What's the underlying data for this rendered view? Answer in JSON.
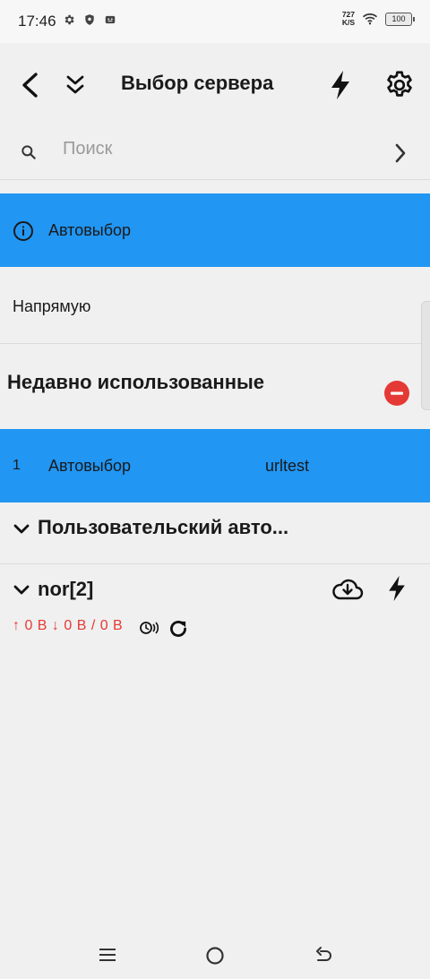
{
  "status_bar": {
    "time": "17:46",
    "net_speed_value": "727",
    "net_speed_unit": "K/S",
    "battery": "100"
  },
  "app_bar": {
    "title": "Выбор сервера"
  },
  "search": {
    "placeholder": "Поиск"
  },
  "rows": {
    "auto_select": "Автовыбор",
    "direct": "Напрямую"
  },
  "recent": {
    "title": "Недавно использованные",
    "items": [
      {
        "index": "1",
        "name": "Автовыбор",
        "type": "urltest"
      }
    ]
  },
  "groups": {
    "custom_title": "Пользовательский авто...",
    "nor_title": "nor[2]"
  },
  "traffic": {
    "text": "↑ 0 B ↓ 0 B / 0 B"
  },
  "colors": {
    "accent_blue": "#2196f3",
    "remove_red": "#e53935",
    "traffic_red": "#e53935"
  },
  "icons": {
    "back": "back-icon",
    "collapse": "double-chevron-down-icon",
    "bolt": "bolt-icon",
    "settings": "gear-icon",
    "search": "search-icon",
    "forward": "chevron-right-icon",
    "info": "info-icon",
    "remove": "remove-circle-icon",
    "expand": "chevron-down-icon",
    "download": "cloud-download-icon",
    "latency": "clock-signal-icon",
    "refresh": "refresh-icon"
  }
}
